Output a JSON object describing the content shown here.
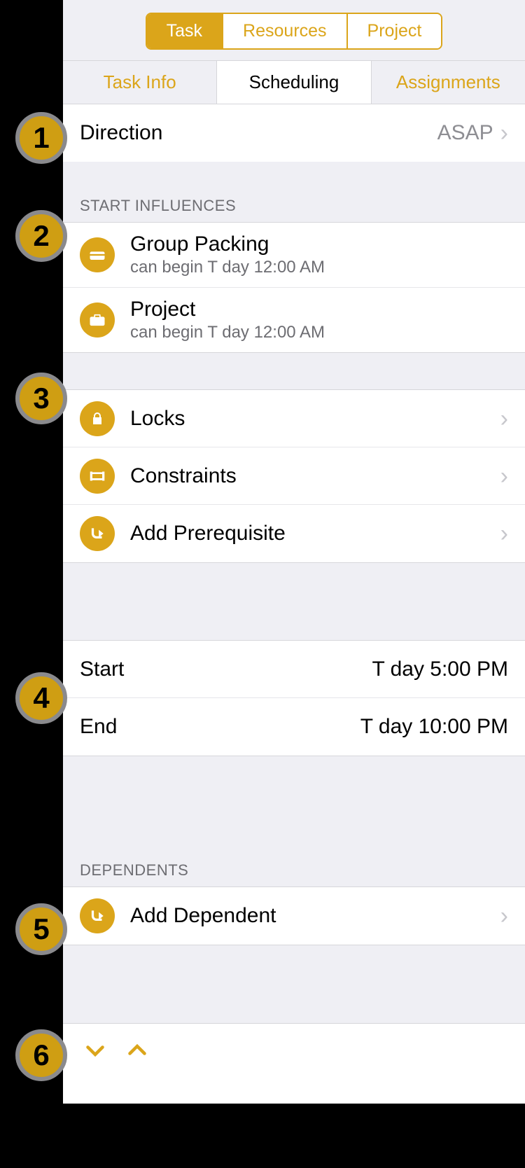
{
  "segmented": {
    "task": "Task",
    "resources": "Resources",
    "project": "Project"
  },
  "tabs": {
    "info": "Task Info",
    "scheduling": "Scheduling",
    "assignments": "Assignments"
  },
  "direction": {
    "label": "Direction",
    "value": "ASAP"
  },
  "sections": {
    "start_influences": "START INFLUENCES",
    "dependents": "DEPENDENTS"
  },
  "influences": [
    {
      "title": "Group Packing",
      "sub": "can begin T day 12:00 AM"
    },
    {
      "title": "Project",
      "sub": "can begin T day 12:00 AM"
    }
  ],
  "links": {
    "locks": "Locks",
    "constraints": "Constraints",
    "add_prereq": "Add Prerequisite",
    "add_dep": "Add Dependent"
  },
  "times": {
    "start_label": "Start",
    "start_value": "T day 5:00 PM",
    "end_label": "End",
    "end_value": "T day 10:00 PM"
  },
  "badges": [
    "1",
    "2",
    "3",
    "4",
    "5",
    "6"
  ]
}
